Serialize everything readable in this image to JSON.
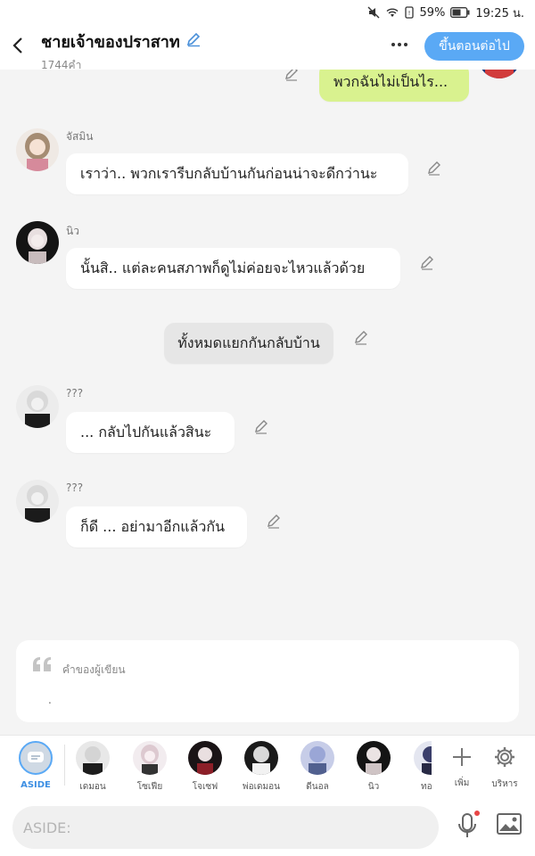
{
  "status_bar": {
    "battery": "59%",
    "time": "19:25 น."
  },
  "header": {
    "title": "ชายเจ้าของปราสาท",
    "word_count": "1744คำ",
    "next_button": "ขึ้นตอนต่อไป"
  },
  "messages": [
    {
      "type": "mine",
      "text": "พวกฉันไม่เป็นไร..."
    },
    {
      "type": "other",
      "sender": "จัสมิน",
      "text": "เราว่า.. พวกเรารีบกลับบ้านกันก่อนน่าจะดีกว่านะ"
    },
    {
      "type": "other",
      "sender": "นิว",
      "text": "นั้นสิ.. แต่ละคนสภาพก็ดูไม่ค่อยจะไหวแล้วด้วย"
    },
    {
      "type": "narration",
      "text": "ทั้งหมดแยกกันกลับบ้าน"
    },
    {
      "type": "other",
      "sender": "???",
      "text": "... กลับไปกันแล้วสินะ"
    },
    {
      "type": "other",
      "sender": "???",
      "text": "ก็ดี ... อย่ามาอีกแล้วกัน"
    }
  ],
  "author_note": {
    "title": "คำของผู้เขียน",
    "text": "."
  },
  "characters": [
    {
      "label": "ASIDE"
    },
    {
      "label": "เดมอน"
    },
    {
      "label": "โซเฟีย"
    },
    {
      "label": "โจเซฟ"
    },
    {
      "label": "พ่อเดมอน"
    },
    {
      "label": "ดีนอล"
    },
    {
      "label": "นิว"
    },
    {
      "label": "ทอ"
    }
  ],
  "tools": {
    "add": "เพิ่ม",
    "manage": "บริหาร"
  },
  "input": {
    "placeholder": "ASIDE:"
  },
  "colors": {
    "accent": "#5aa9f5",
    "my_bubble": "#d9f28f",
    "background": "#f4f4f4"
  }
}
